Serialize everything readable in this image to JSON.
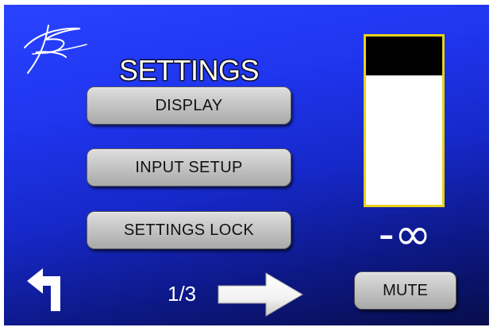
{
  "title": "SETTINGS",
  "menu": {
    "display_label": "DISPLAY",
    "input_setup_label": "INPUT SETUP",
    "settings_lock_label": "SETTINGS LOCK"
  },
  "meter": {
    "level_fraction": 0.23,
    "value_text": "-∞",
    "border_color": "#e9d21a"
  },
  "nav": {
    "back_icon": "back-arrow-icon",
    "page_indicator": "1/3",
    "next_icon": "next-arrow-icon"
  },
  "mute_label": "MUTE",
  "logo_icon": "signature-logo-icon"
}
